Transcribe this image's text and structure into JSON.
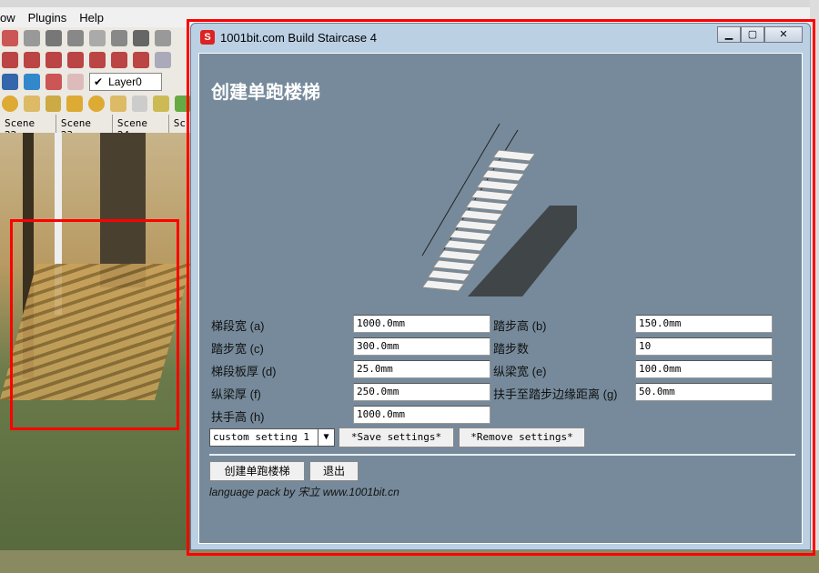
{
  "host": {
    "menu": [
      "ow",
      "Plugins",
      "Help"
    ],
    "layer": "Layer0",
    "scenes": [
      "Scene 22",
      "Scene 23",
      "Scene 24",
      "Sc"
    ]
  },
  "dialog": {
    "title": "1001bit.com Build Staircase 4",
    "heading": "创建单跑楼梯",
    "fields": [
      {
        "label": "梯段宽 (a)",
        "value": "1000.0mm"
      },
      {
        "label": "踏步高 (b)",
        "value": "150.0mm"
      },
      {
        "label": "踏步宽 (c)",
        "value": "300.0mm"
      },
      {
        "label": "踏步数",
        "value": "10"
      },
      {
        "label": "梯段板厚 (d)",
        "value": "25.0mm"
      },
      {
        "label": "纵梁宽 (e)",
        "value": "100.0mm"
      },
      {
        "label": "纵梁厚 (f)",
        "value": "250.0mm"
      },
      {
        "label": "扶手至踏步边缘距离 (g)",
        "value": "50.0mm"
      },
      {
        "label": "扶手高 (h)",
        "value": "1000.0mm"
      }
    ],
    "preset": "custom setting 1",
    "save": "*Save settings*",
    "remove": "*Remove settings*",
    "create": "创建单跑楼梯",
    "exit": "退出",
    "credit": "language pack by 宋立 www.1001bit.cn"
  },
  "colors": {
    "panel": "#768a9b",
    "highlight": "#ff0000"
  }
}
